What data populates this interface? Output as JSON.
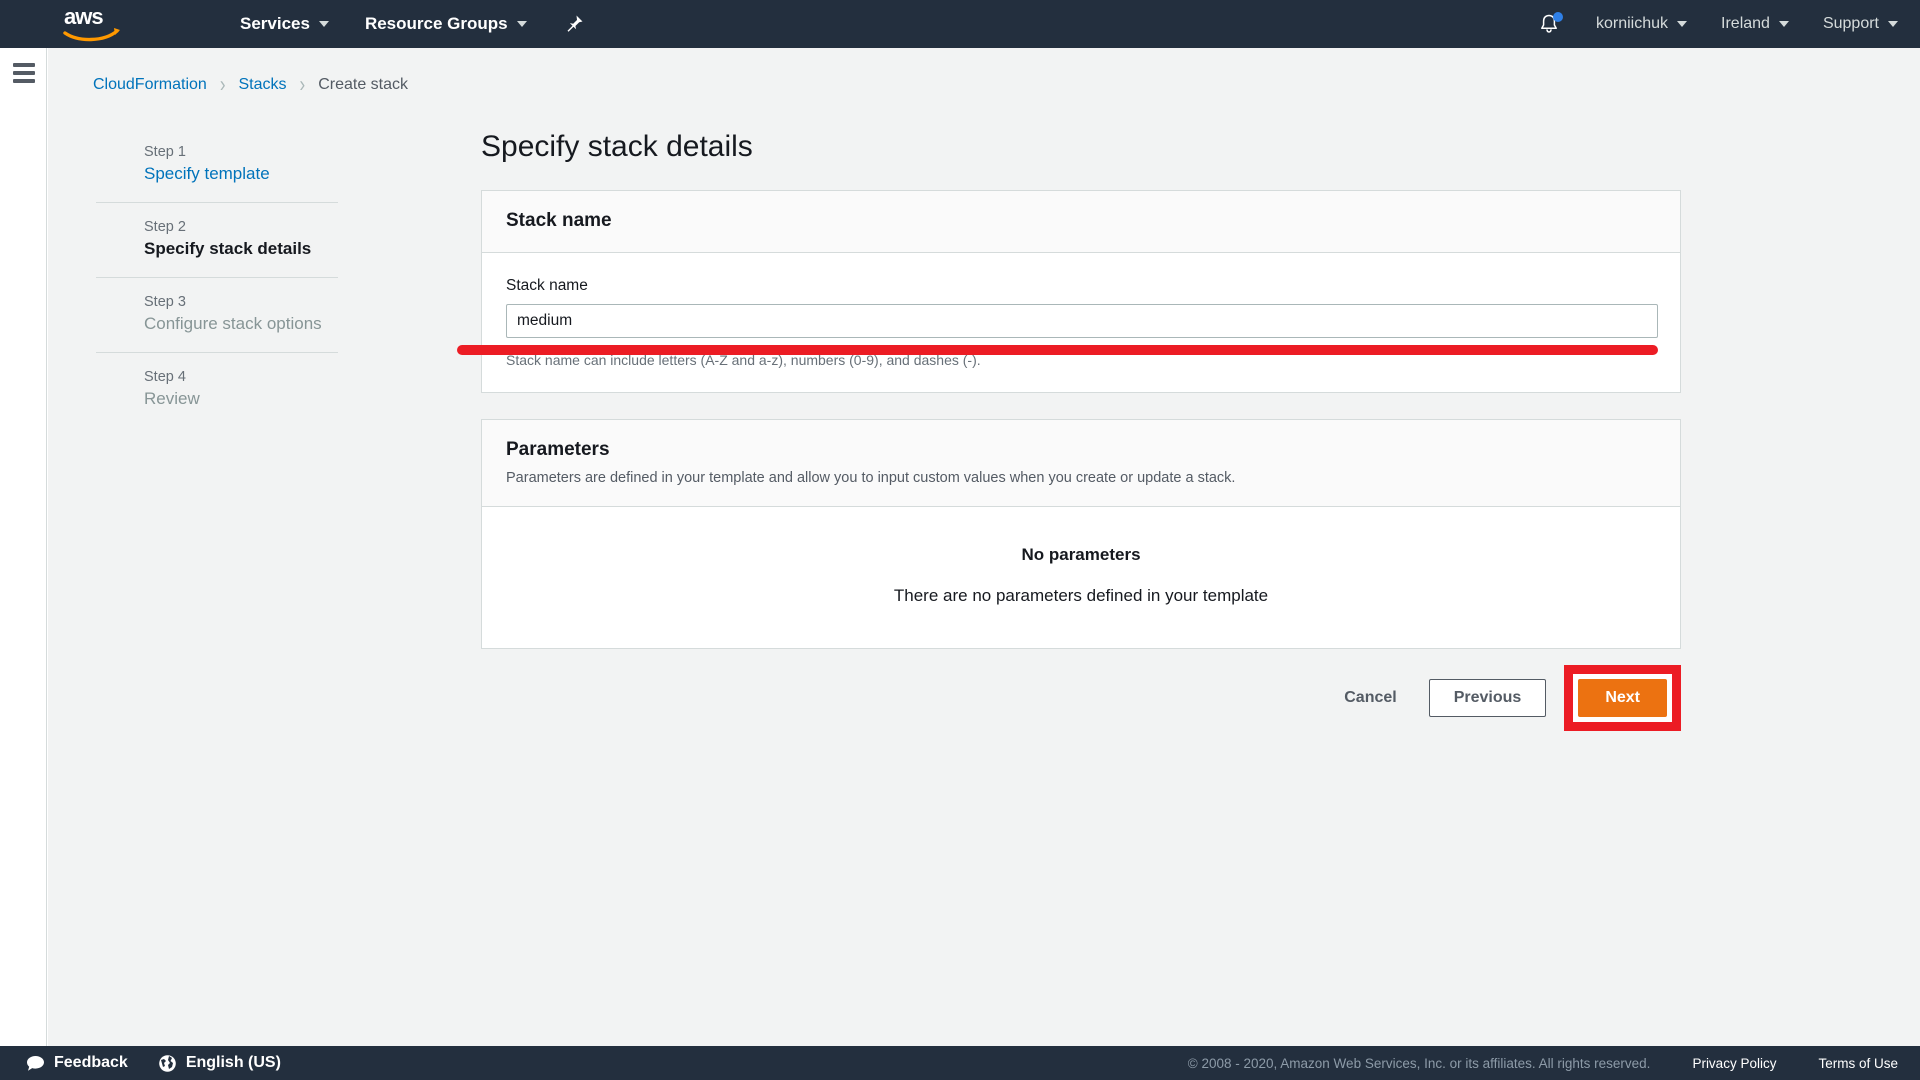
{
  "topnav": {
    "logo_alt": "aws",
    "items": [
      {
        "label": "Services",
        "has_caret": true
      },
      {
        "label": "Resource Groups",
        "has_caret": true
      }
    ],
    "pin_icon": "pin-icon",
    "bell_icon": "bell-icon",
    "right_items": [
      {
        "label": "korniichuk",
        "has_caret": true
      },
      {
        "label": "Ireland",
        "has_caret": true
      },
      {
        "label": "Support",
        "has_caret": true
      }
    ]
  },
  "sidebar": {
    "menu_icon": "hamburger-icon"
  },
  "breadcrumb": {
    "items": [
      {
        "label": "CloudFormation",
        "type": "link"
      },
      {
        "label": "Stacks",
        "type": "link"
      },
      {
        "label": "Create stack",
        "type": "current"
      }
    ],
    "separator": "›"
  },
  "steps": [
    {
      "num": "Step 1",
      "label": "Specify template",
      "state": "link"
    },
    {
      "num": "Step 2",
      "label": "Specify stack details",
      "state": "active"
    },
    {
      "num": "Step 3",
      "label": "Configure stack options",
      "state": "muted"
    },
    {
      "num": "Step 4",
      "label": "Review",
      "state": "muted"
    }
  ],
  "main": {
    "page_title": "Specify stack details",
    "stack_name_card": {
      "title": "Stack name",
      "field_label": "Stack name",
      "value": "medium",
      "placeholder": "",
      "hint": "Stack name can include letters (A-Z and a-z), numbers (0-9), and dashes (-)."
    },
    "parameters_card": {
      "title": "Parameters",
      "subtitle": "Parameters are defined in your template and allow you to input custom values when you create or update a stack.",
      "empty_title": "No parameters",
      "empty_subtitle": "There are no parameters defined in your template"
    },
    "actions": {
      "cancel_label": "Cancel",
      "previous_label": "Previous",
      "next_label": "Next"
    }
  },
  "footer": {
    "feedback_label": "Feedback",
    "language_label": "English (US)",
    "copyright": "© 2008 - 2020, Amazon Web Services, Inc. or its affiliates. All rights reserved.",
    "privacy_label": "Privacy Policy",
    "terms_label": "Terms of Use"
  },
  "colors": {
    "nav_bg": "#232f3e",
    "accent_orange": "#ec7211",
    "link_blue": "#0073bb",
    "annotation_red": "#ec1c24",
    "content_bg": "#f2f3f3"
  }
}
